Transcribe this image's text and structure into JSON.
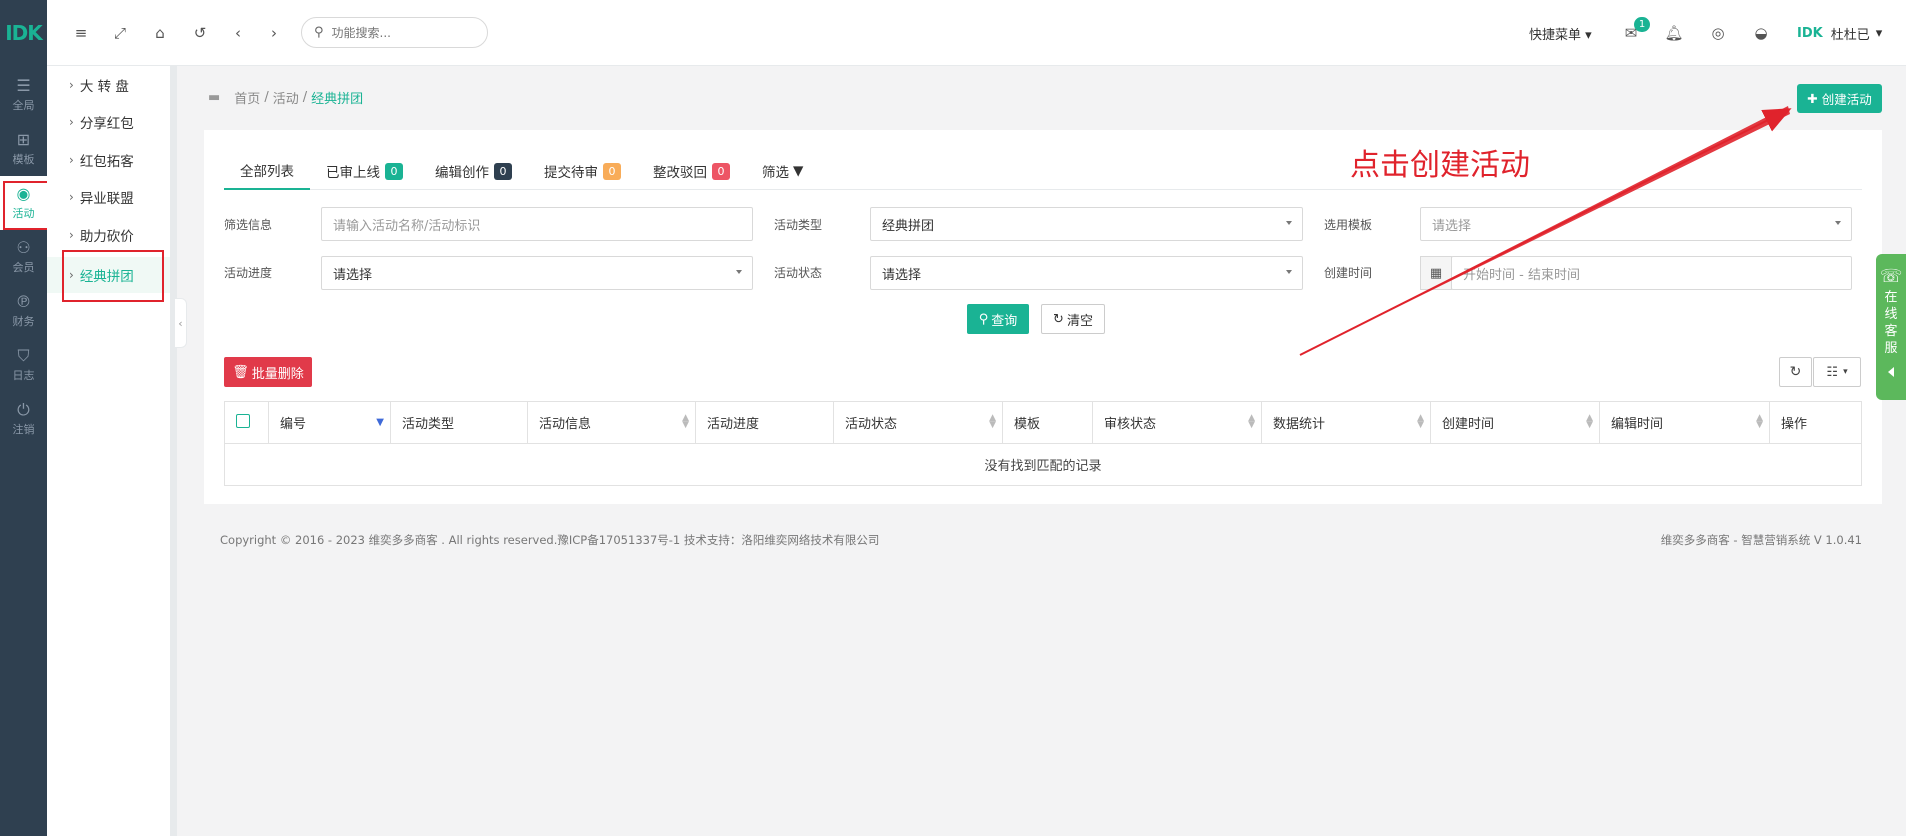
{
  "leftbar": {
    "logo": "IDK",
    "items": [
      {
        "label": "全局",
        "icon": "sliders-icon"
      },
      {
        "label": "模板",
        "icon": "sitemap-icon"
      },
      {
        "label": "活动",
        "icon": "map-pin-icon"
      },
      {
        "label": "会员",
        "icon": "users-icon"
      },
      {
        "label": "财务",
        "icon": "paypal-icon"
      },
      {
        "label": "日志",
        "icon": "shield-icon"
      },
      {
        "label": "注销",
        "icon": "power-icon"
      }
    ]
  },
  "submenu": {
    "items": [
      {
        "label": "大 转 盘"
      },
      {
        "label": "分享红包"
      },
      {
        "label": "红包拓客"
      },
      {
        "label": "异业联盟"
      },
      {
        "label": "助力砍价"
      },
      {
        "label": "经典拼团"
      }
    ]
  },
  "topbar": {
    "search_placeholder": "功能搜索...",
    "quick_menu": "快捷菜单",
    "mail_badge": "1",
    "brand": "IDK",
    "username": "杜杜已"
  },
  "breadcrumb": {
    "home": "首页",
    "section": "活动",
    "current": "经典拼团",
    "sep": "/"
  },
  "create_button": "创建活动",
  "tabs": [
    {
      "label": "全部列表",
      "count": null,
      "color": null
    },
    {
      "label": "已审上线",
      "count": "0",
      "color": "green"
    },
    {
      "label": "编辑创作",
      "count": "0",
      "color": "dark"
    },
    {
      "label": "提交待审",
      "count": "0",
      "color": "yellow"
    },
    {
      "label": "整改驳回",
      "count": "0",
      "color": "red"
    },
    {
      "label": "筛选",
      "count": null,
      "color": null
    }
  ],
  "filters": {
    "filter_info": {
      "label": "筛选信息",
      "placeholder": "请输入活动名称/活动标识"
    },
    "activity_type": {
      "label": "活动类型",
      "value": "经典拼团"
    },
    "template": {
      "label": "选用模板",
      "value": "请选择"
    },
    "progress": {
      "label": "活动进度",
      "value": "请选择"
    },
    "status": {
      "label": "活动状态",
      "value": "请选择"
    },
    "created_time": {
      "label": "创建时间",
      "placeholder": "开始时间 - 结束时间"
    }
  },
  "buttons": {
    "query": "查询",
    "clear": "清空",
    "batch_delete": "批量删除"
  },
  "table": {
    "columns": [
      "编号",
      "活动类型",
      "活动信息",
      "活动进度",
      "活动状态",
      "模板",
      "审核状态",
      "数据统计",
      "创建时间",
      "编辑时间",
      "操作"
    ],
    "empty_text": "没有找到匹配的记录"
  },
  "footer": {
    "left": "Copyright © 2016 - 2023 维奕多多商客 . All rights reserved.豫ICP备17051337号-1 技术支持：洛阳维奕网络技术有限公司",
    "right": "维奕多多商客 - 智慧营销系统 V 1.0.41"
  },
  "annotation": "点击创建活动",
  "service_tab": [
    "在",
    "线",
    "客",
    "服"
  ],
  "colors": {
    "accent": "#1ab394",
    "danger": "#e13a4a",
    "annotation": "#e0232c",
    "sidebar": "#2f4050"
  }
}
